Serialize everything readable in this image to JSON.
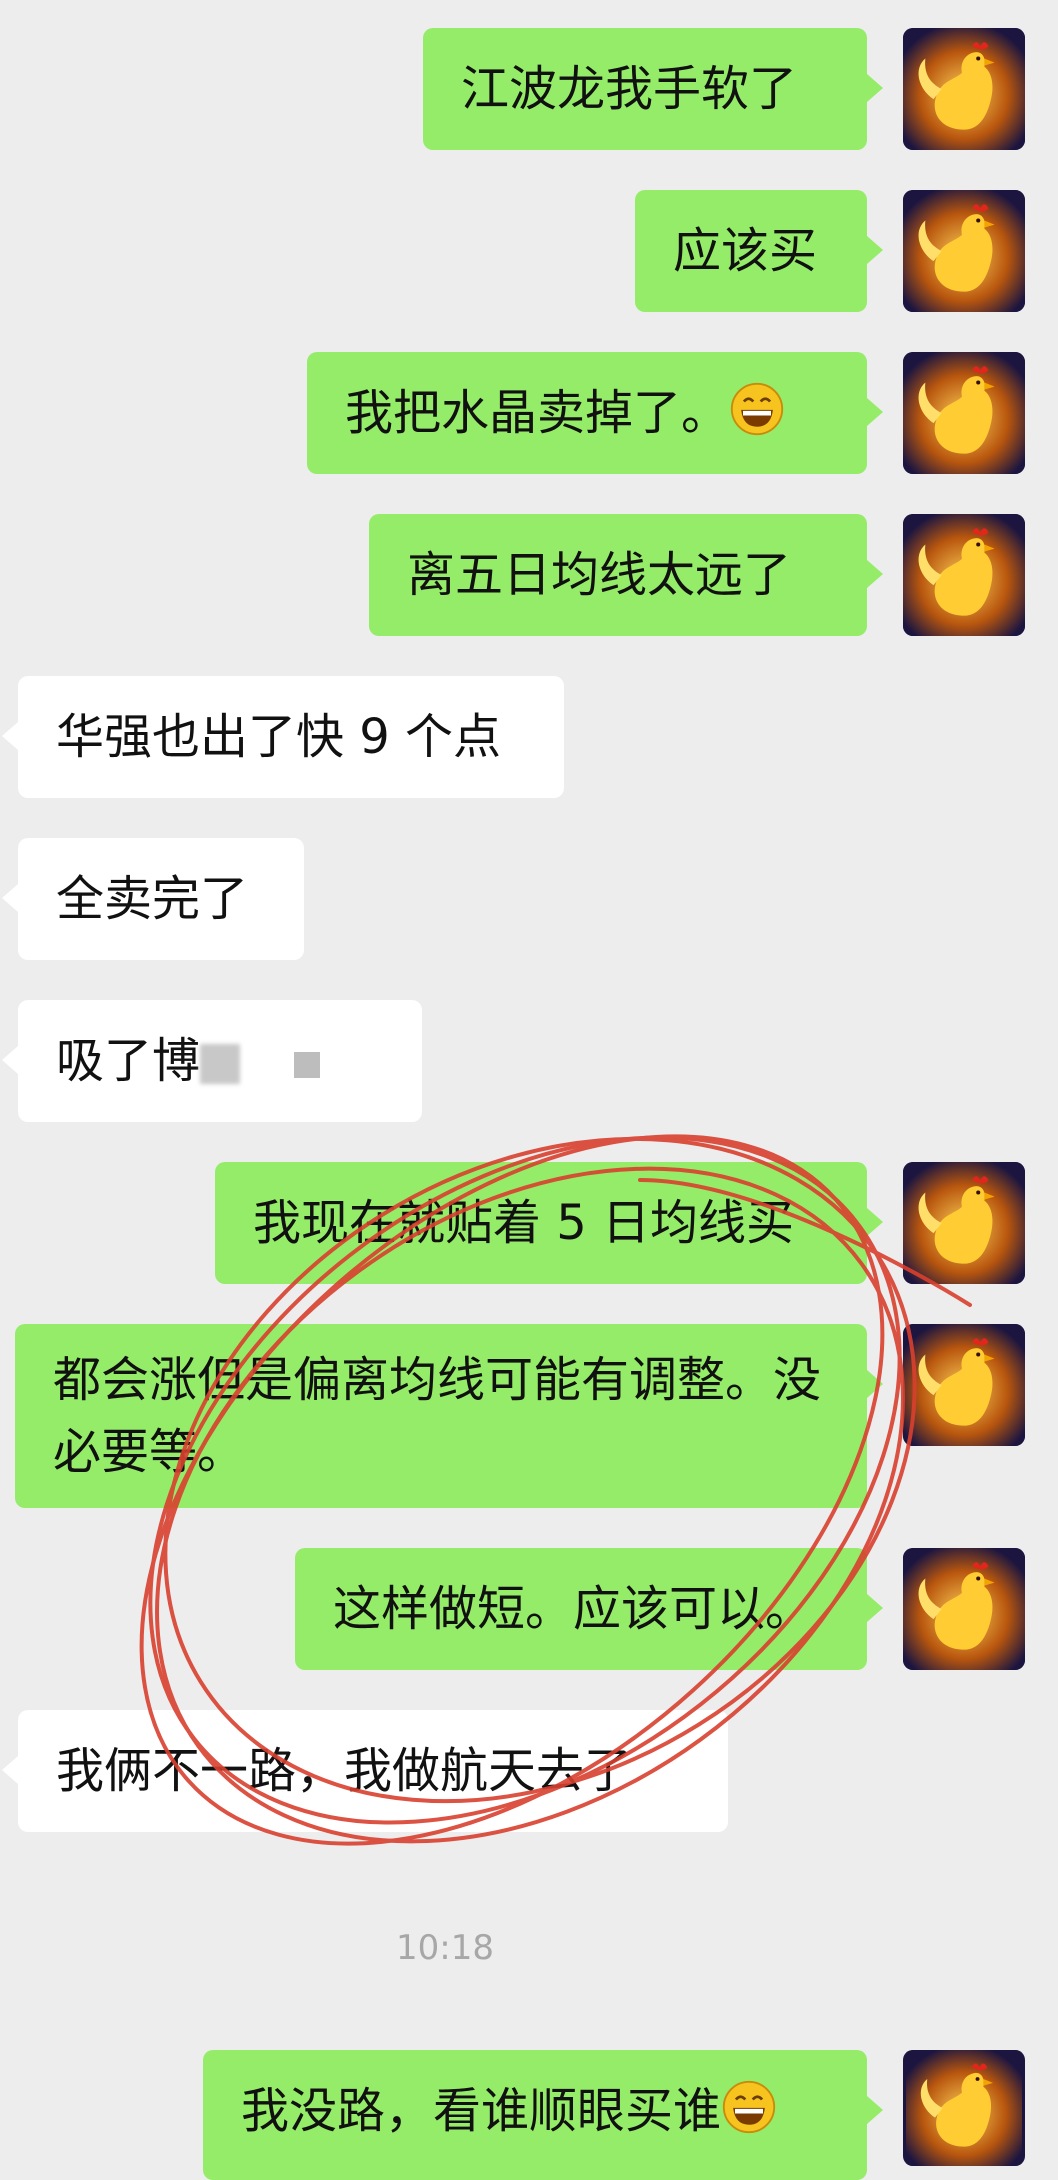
{
  "messages": [
    {
      "text": "江波龙我手软了"
    },
    {
      "text": "应该买"
    },
    {
      "text": "我把水晶卖掉了。",
      "emoji": "grinning-face-emoji"
    },
    {
      "text": "离五日均线太远了"
    },
    {
      "text": "华强也出了快 9 个点"
    },
    {
      "text": "全卖完了"
    },
    {
      "text": "吸了博"
    },
    {
      "text": "我现在就贴着 5 日均线买"
    },
    {
      "text": "都会涨但是偏离均线可能有调整。没必要等。"
    },
    {
      "text": "这样做短。应该可以。"
    },
    {
      "text": "我俩不一路，我做航天去了"
    },
    {
      "text": "我没路，看谁顺眼买谁",
      "emoji": "grinning-face-emoji"
    }
  ],
  "timestamp": "10:18",
  "colors": {
    "background": "#ededed",
    "sent_bubble": "#95ec69",
    "received_bubble": "#ffffff",
    "annotation_ink": "#d9402f"
  },
  "icons": {
    "avatar": "golden-rooster-avatar",
    "emoji": "grinning-face-emoji"
  }
}
